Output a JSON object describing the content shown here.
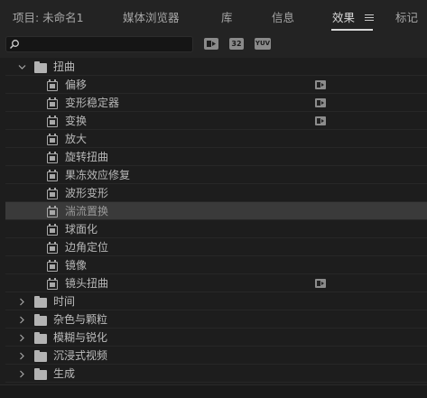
{
  "tabs": [
    {
      "label": "项目: 未命名1"
    },
    {
      "label": "媒体浏览器"
    },
    {
      "label": "库"
    },
    {
      "label": "信息"
    },
    {
      "label": "效果"
    },
    {
      "label": "标记"
    }
  ],
  "active_tab": "效果",
  "search": {
    "value": "",
    "placeholder": ""
  },
  "toolbar_buttons": [
    {
      "label": "",
      "icon": "accelerated-effects-icon"
    },
    {
      "label": "32",
      "icon": "32bit-color-icon"
    },
    {
      "label": "YUV",
      "icon": "yuv-effects-icon"
    }
  ],
  "tree": {
    "expanded_folder": {
      "label": "扭曲",
      "items": [
        {
          "label": "偏移",
          "accelerated": true
        },
        {
          "label": "变形稳定器",
          "accelerated": true
        },
        {
          "label": "变换",
          "accelerated": true
        },
        {
          "label": "放大",
          "accelerated": false
        },
        {
          "label": "旋转扭曲",
          "accelerated": false
        },
        {
          "label": "果冻效应修复",
          "accelerated": false
        },
        {
          "label": "波形变形",
          "accelerated": false
        },
        {
          "label": "湍流置换",
          "accelerated": false,
          "selected": true
        },
        {
          "label": "球面化",
          "accelerated": false
        },
        {
          "label": "边角定位",
          "accelerated": false
        },
        {
          "label": "镜像",
          "accelerated": false
        },
        {
          "label": "镜头扭曲",
          "accelerated": true
        }
      ]
    },
    "collapsed_folders": [
      {
        "label": "时间"
      },
      {
        "label": "杂色与颗粒"
      },
      {
        "label": "模糊与锐化"
      },
      {
        "label": "沉浸式视频"
      },
      {
        "label": "生成"
      }
    ]
  },
  "colors": {
    "background": "#1d1d1d",
    "selected_row": "#3a3a3a",
    "text": "#b8b8b8"
  }
}
